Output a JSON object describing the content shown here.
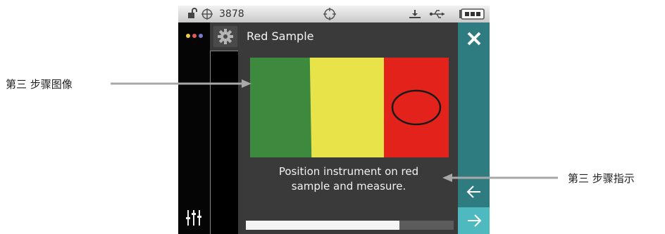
{
  "annotations": {
    "left_label": "第三 步骤图像",
    "right_label": "第三 步骤指示"
  },
  "status_bar": {
    "counter": "3878"
  },
  "header": {
    "title": "Red Sample"
  },
  "sample_image": {
    "swatches": [
      "green",
      "yellow",
      "red"
    ],
    "colors": {
      "green": "#3d8a3e",
      "yellow": "#e9e34a",
      "red": "#e2221b"
    }
  },
  "instruction": {
    "line1": "Position instrument on red",
    "line2": "sample and measure."
  },
  "progress": {
    "fraction": 0.74
  },
  "colors": {
    "accent": "#2e7b80",
    "accent_light": "#4fb9c0"
  },
  "icons": [
    "lock-icon",
    "crosshair-icon",
    "target-icon",
    "usb-icon",
    "battery-icon",
    "dots-icon",
    "gear-icon",
    "sliders-icon",
    "close-icon",
    "back-arrow-icon",
    "next-arrow-icon"
  ]
}
